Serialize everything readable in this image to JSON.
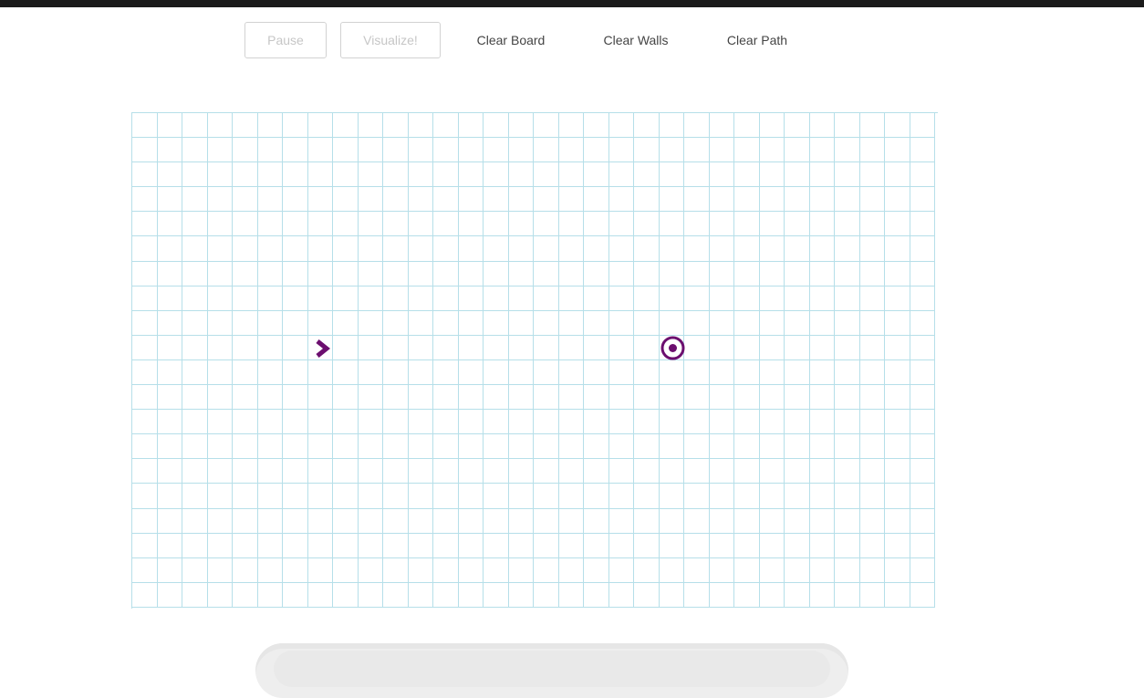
{
  "toolbar": {
    "pause_label": "Pause",
    "visualize_label": "Visualize!",
    "clear_board_label": "Clear Board",
    "clear_walls_label": "Clear Walls",
    "clear_path_label": "Clear Path"
  },
  "grid": {
    "rows": 20,
    "cols": 32,
    "start_node": {
      "row": 9,
      "col": 7,
      "icon": "chevron-right-icon"
    },
    "target_node": {
      "row": 9,
      "col": 21,
      "icon": "target-icon"
    }
  },
  "colors": {
    "grid_line": "#b6dfe9",
    "node_accent": "#6c0f6f",
    "top_strip": "#1b1b1b",
    "disabled_button_text": "#c6c6c6"
  }
}
